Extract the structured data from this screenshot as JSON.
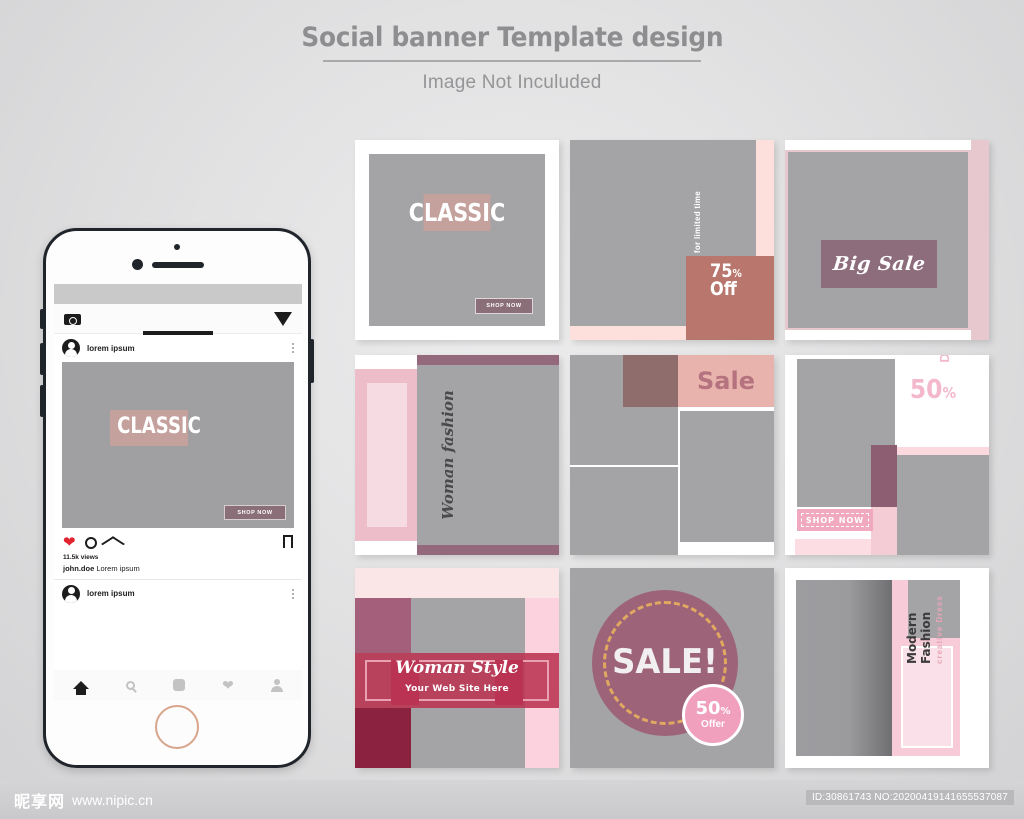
{
  "header": {
    "title": "Social banner Template design",
    "subtitle": "Image Not Inculuded"
  },
  "phone": {
    "app_bar": {
      "camera_icon": "camera-icon",
      "send_icon": "send-icon"
    },
    "post": {
      "username": "lorem ipsum",
      "menu_icon": "more-options-icon",
      "image_text": "CLASSIC",
      "shop_button": "SHOP NOW",
      "like_icon": "heart-icon",
      "comment_icon": "comment-icon",
      "share_icon": "direct-message-icon",
      "save_icon": "bookmark-icon",
      "views": "11.5k views",
      "caption_user": "john.doe",
      "caption_text": "Lorem ipsum"
    },
    "post2": {
      "username": "lorem ipsum"
    },
    "tabbar": {
      "home": "home-icon",
      "search": "search-icon",
      "reels": "square-icon",
      "activity": "heart-icon",
      "profile": "person-icon"
    }
  },
  "cards": [
    {
      "id": "classic-frame",
      "title": "CLASSIC",
      "button": "SHOP NOW"
    },
    {
      "id": "limited-time-offer",
      "vertical": "for limited time",
      "percent": "75",
      "percent_symbol": "%",
      "off": "Off"
    },
    {
      "id": "big-sale",
      "title": "Big Sale"
    },
    {
      "id": "woman-fashion",
      "vertical": "Woman fashion"
    },
    {
      "id": "sale-collage",
      "title": "Sale"
    },
    {
      "id": "fifty-discount",
      "percent": "50",
      "percent_symbol": "%",
      "discount": "Discount",
      "button": "SHOP NOW"
    },
    {
      "id": "woman-style",
      "title": "Woman Style",
      "subtitle": "Your Web Site Here"
    },
    {
      "id": "sale-circle",
      "title": "SALE!",
      "badge_value": "50",
      "badge_symbol": "%",
      "badge_label": "Offer"
    },
    {
      "id": "modern-fashion",
      "vertical": "Modern Fashion",
      "vertical_sub": "creative Dress"
    }
  ],
  "footer": {
    "watermark_cn": "昵享网",
    "watermark_url": "www.nipic.cn",
    "id_tag": "ID:30861743 NO:20200419141655537087"
  },
  "colors": {
    "background": "#e2e2e3",
    "placeholder_gray": "#a4a4a7",
    "mauve": "#8d6d7b",
    "pink": "#f1a9c0",
    "salmon": "#e79a90",
    "crimson": "#bb3352",
    "deep_red": "#8b2340",
    "orange_dash": "#e0a860",
    "title_gray": "#8e8e90"
  }
}
